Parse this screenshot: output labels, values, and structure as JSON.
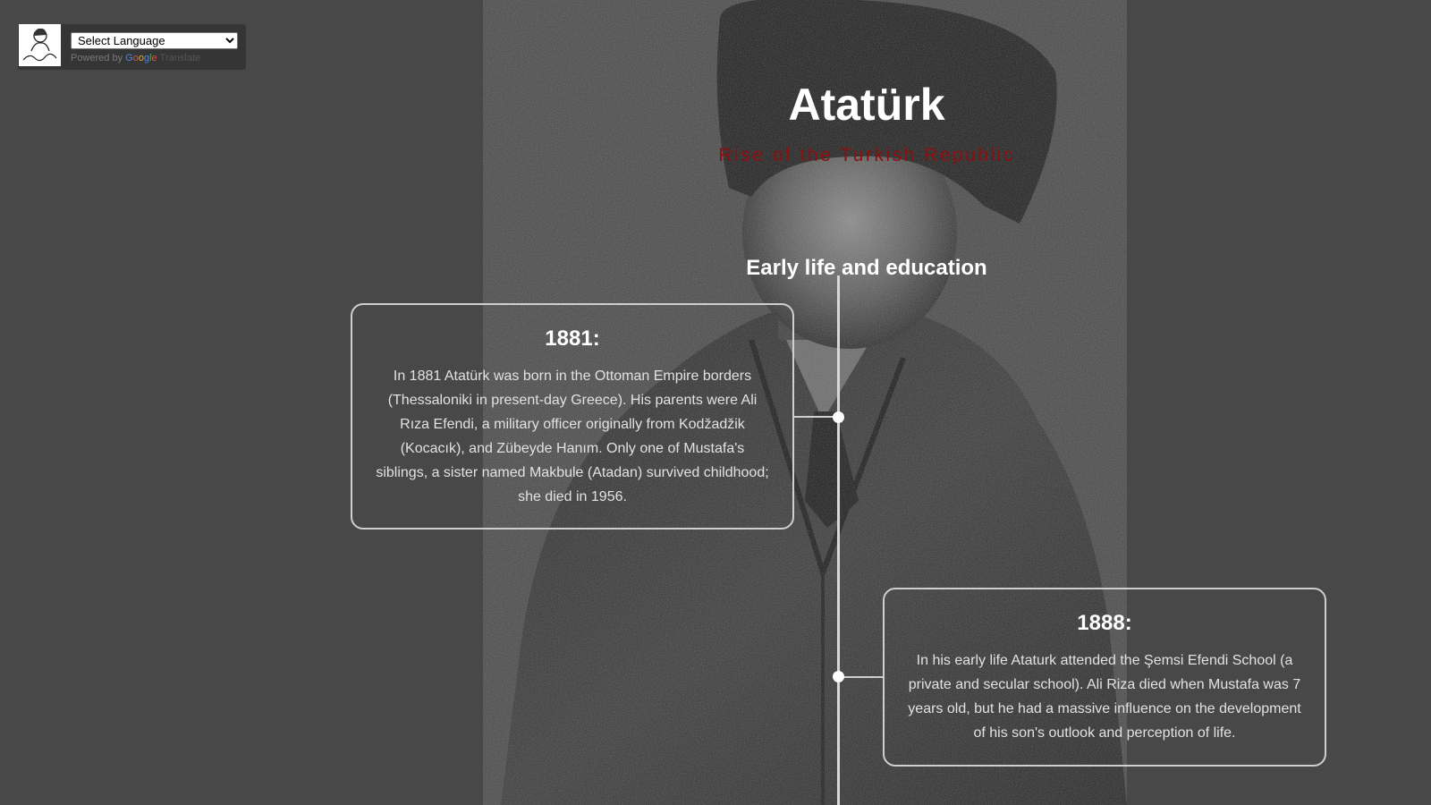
{
  "translate_widget": {
    "logo": "ataturk-signature-portrait-logo",
    "select_value": "Select Language",
    "powered_by": "Powered by",
    "google_letters": [
      "G",
      "o",
      "o",
      "g",
      "l",
      "e"
    ],
    "translate_label": "Translate"
  },
  "header": {
    "title": "Atatürk",
    "subtitle": "Rise of the Turkish Republic"
  },
  "section": {
    "heading": "Early life and education"
  },
  "timeline": {
    "events": [
      {
        "year": "1881:",
        "text": "In 1881 Atatürk was born in the Ottoman Empire borders (Thessaloniki in present-day Greece). His parents were Ali Rıza Efendi, a military officer originally from Kodžadžik (Kocacık), and Zübeyde Hanım. Only one of Mustafa's siblings, a sister named Makbule (Atadan) survived childhood; she died in 1956."
      },
      {
        "year": "1888:",
        "text": "In his early life Ataturk attended the Şemsi Efendi School (a private and secular school). Ali Riza died when Mustafa was 7 years old, but he had a massive influence on the development of his son's outlook and perception of life."
      }
    ]
  },
  "colors": {
    "background": "#484848",
    "subtitle": "#8e0f0f",
    "timeline": "#d8d8d8",
    "card_border": "#cfcfcf"
  }
}
